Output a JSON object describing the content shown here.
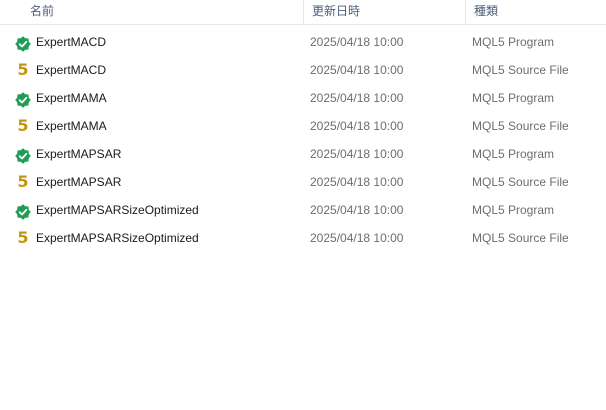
{
  "header": {
    "name_label": "名前",
    "date_label": "更新日時",
    "type_label": "種類",
    "sort_glyph": "^"
  },
  "colors": {
    "program_icon": "#1f9d55",
    "source_icon": "#c9920e"
  },
  "files": [
    {
      "icon": "mql5-program-icon",
      "glyph": "",
      "name": "ExpertMACD",
      "date": "2025/04/18 10:00",
      "type": "MQL5 Program"
    },
    {
      "icon": "mql5-source-icon",
      "glyph": "5",
      "name": "ExpertMACD",
      "date": "2025/04/18 10:00",
      "type": "MQL5 Source File"
    },
    {
      "icon": "mql5-program-icon",
      "glyph": "",
      "name": "ExpertMAMA",
      "date": "2025/04/18 10:00",
      "type": "MQL5 Program"
    },
    {
      "icon": "mql5-source-icon",
      "glyph": "5",
      "name": "ExpertMAMA",
      "date": "2025/04/18 10:00",
      "type": "MQL5 Source File"
    },
    {
      "icon": "mql5-program-icon",
      "glyph": "",
      "name": "ExpertMAPSAR",
      "date": "2025/04/18 10:00",
      "type": "MQL5 Program"
    },
    {
      "icon": "mql5-source-icon",
      "glyph": "5",
      "name": "ExpertMAPSAR",
      "date": "2025/04/18 10:00",
      "type": "MQL5 Source File"
    },
    {
      "icon": "mql5-program-icon",
      "glyph": "",
      "name": "ExpertMAPSARSizeOptimized",
      "date": "2025/04/18 10:00",
      "type": "MQL5 Program"
    },
    {
      "icon": "mql5-source-icon",
      "glyph": "5",
      "name": "ExpertMAPSARSizeOptimized",
      "date": "2025/04/18 10:00",
      "type": "MQL5 Source File"
    }
  ]
}
